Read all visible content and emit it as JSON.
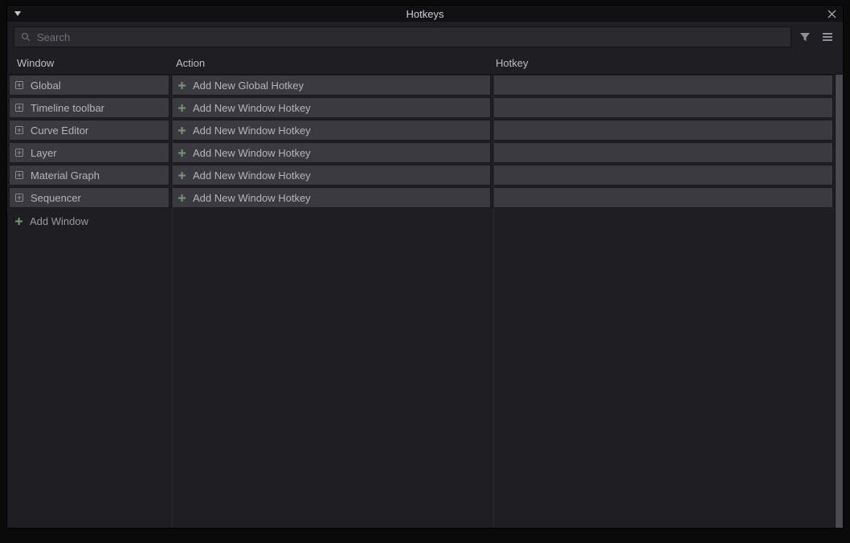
{
  "title": "Hotkeys",
  "search": {
    "placeholder": "Search",
    "value": ""
  },
  "columns": {
    "window": "Window",
    "action": "Action",
    "hotkey": "Hotkey"
  },
  "rows": [
    {
      "window": "Global",
      "action": "Add New Global Hotkey",
      "hotkey": ""
    },
    {
      "window": "Timeline toolbar",
      "action": "Add New Window Hotkey",
      "hotkey": ""
    },
    {
      "window": "Curve Editor",
      "action": "Add New Window Hotkey",
      "hotkey": ""
    },
    {
      "window": "Layer",
      "action": "Add New Window Hotkey",
      "hotkey": ""
    },
    {
      "window": "Material Graph",
      "action": "Add New Window Hotkey",
      "hotkey": ""
    },
    {
      "window": "Sequencer",
      "action": "Add New Window Hotkey",
      "hotkey": ""
    }
  ],
  "addWindow": "Add Window"
}
